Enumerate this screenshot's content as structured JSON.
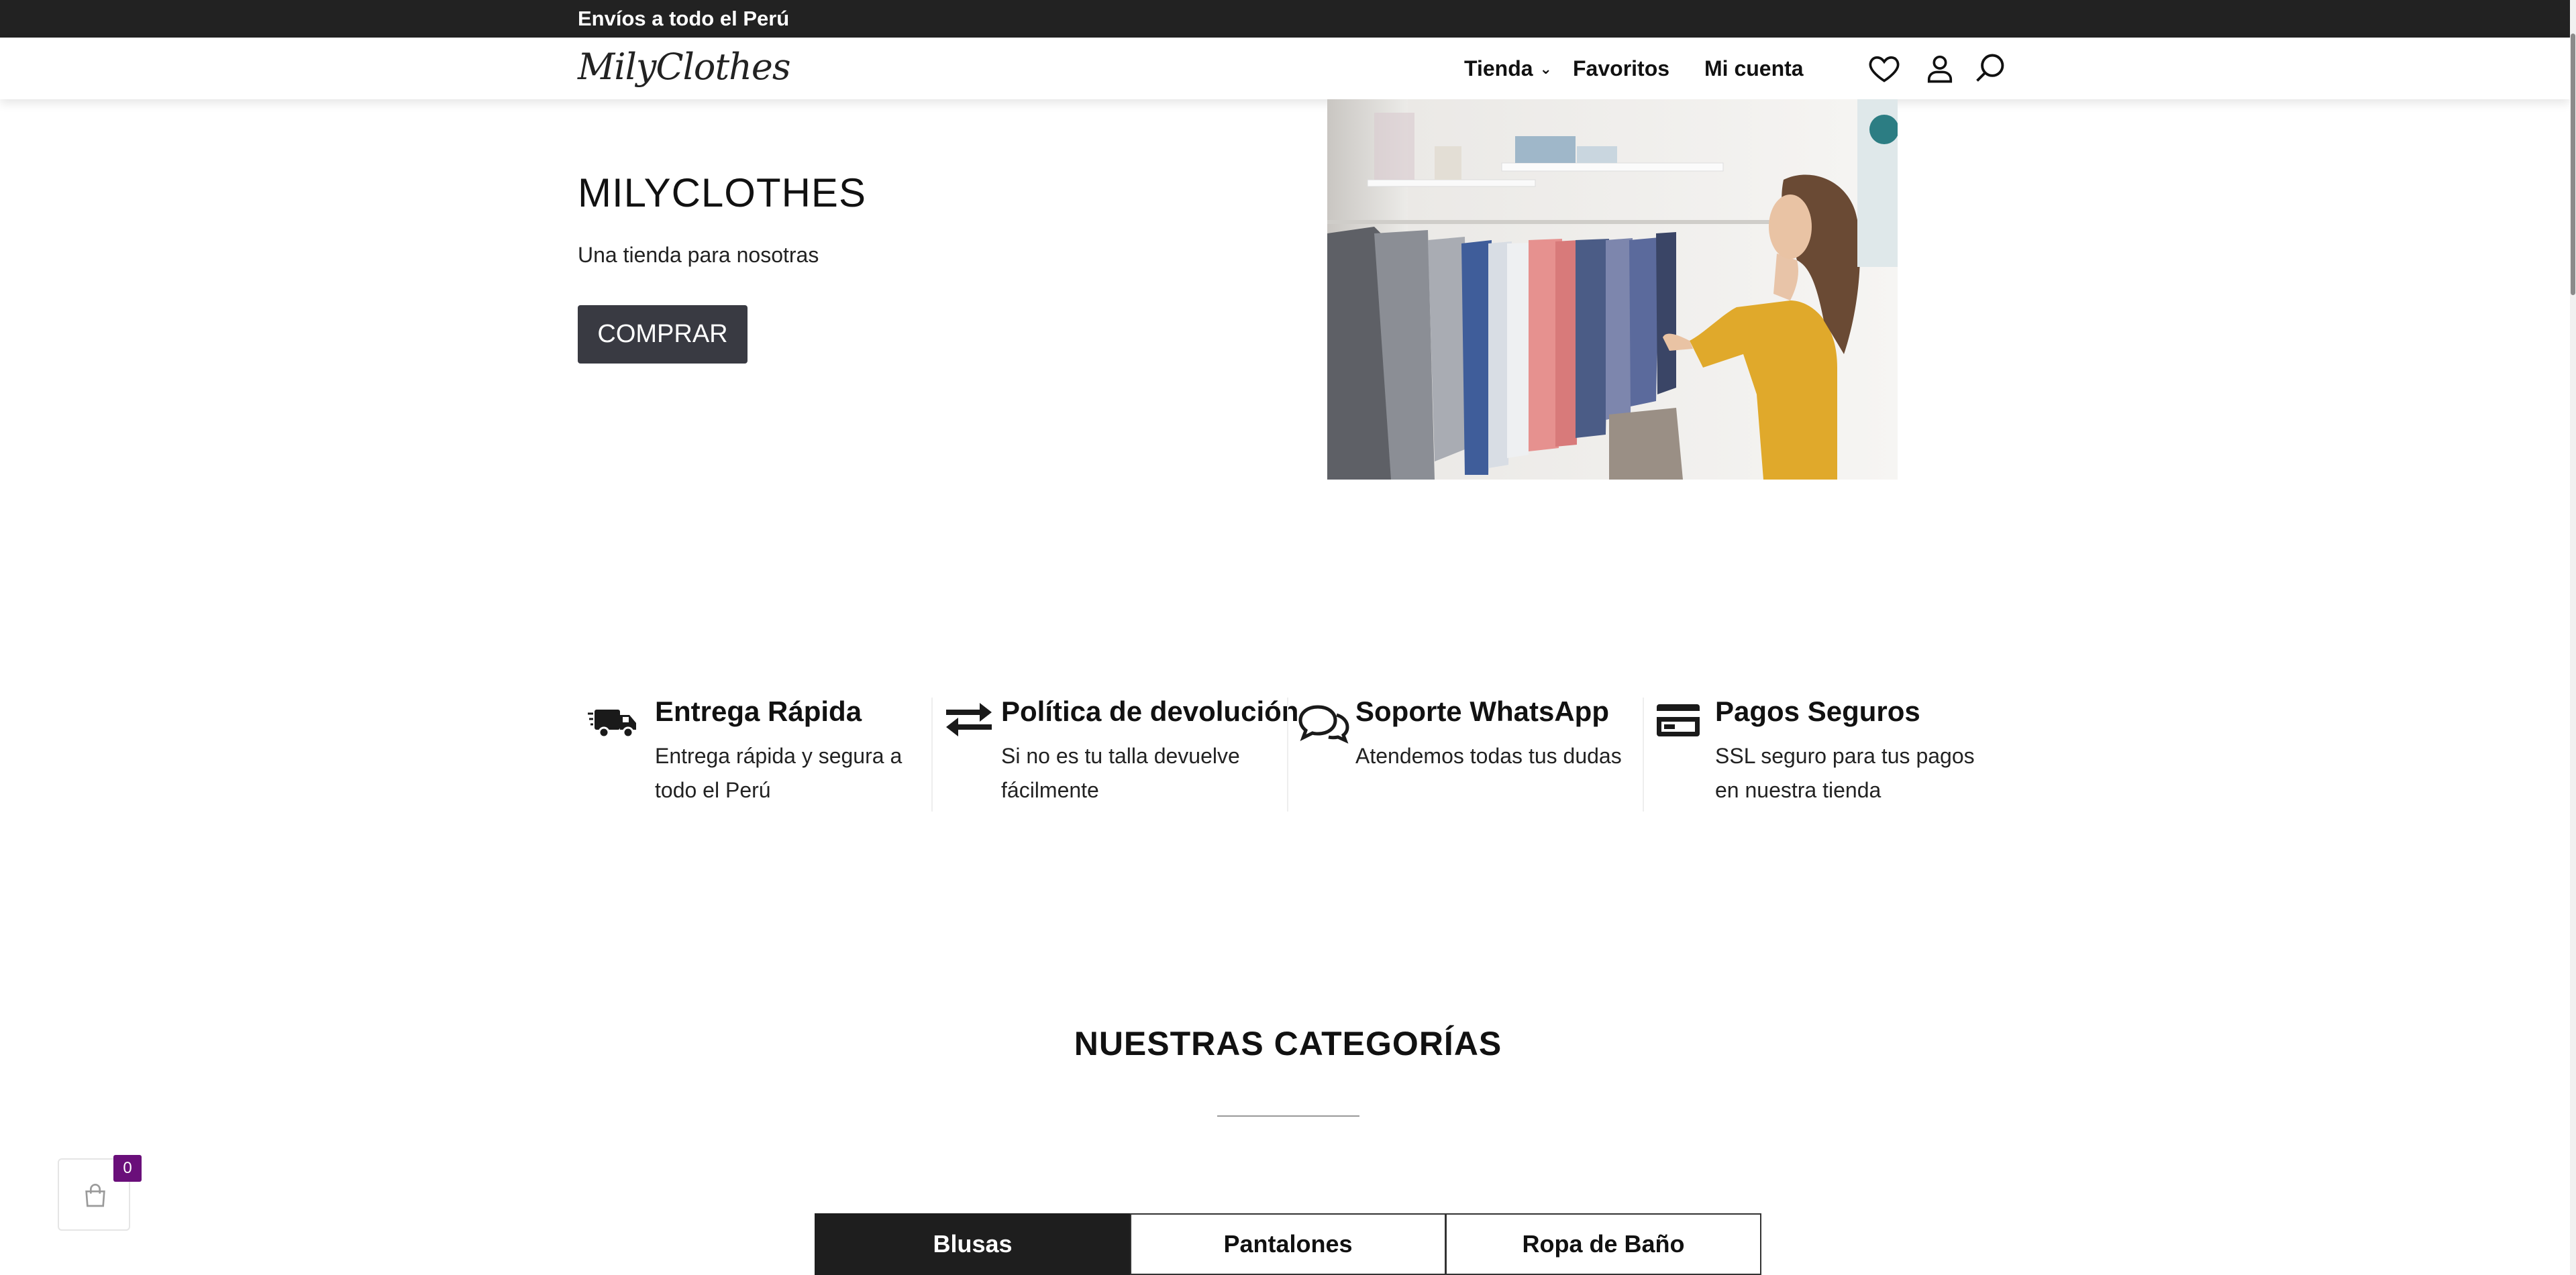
{
  "announcement": "Envíos a todo el Perú",
  "header": {
    "logo": "MilyClothes",
    "nav": [
      {
        "label": "Tienda",
        "has_dropdown": true
      },
      {
        "label": "Favoritos"
      },
      {
        "label": "Mi cuenta"
      }
    ],
    "icons": [
      "heart-icon",
      "user-icon",
      "search-icon"
    ]
  },
  "hero": {
    "title": "MILYCLOTHES",
    "subtitle": "Una tienda para nosotras",
    "cta_label": "COMPRAR"
  },
  "features": [
    {
      "icon": "delivery-truck-icon",
      "title": "Entrega Rápida",
      "line1": "Entrega rápida y segura a",
      "line2": "todo el Perú"
    },
    {
      "icon": "exchange-arrows-icon",
      "title": "Política de devolución",
      "line1": "Si no es tu talla devuelve",
      "line2": "fácilmente"
    },
    {
      "icon": "chat-bubbles-icon",
      "title": "Soporte WhatsApp",
      "line1": "Atendemos todas tus dudas",
      "line2": ""
    },
    {
      "icon": "credit-card-icon",
      "title": "Pagos Seguros",
      "line1": "SSL seguro para tus pagos",
      "line2": "en nuestra tienda"
    }
  ],
  "categories": {
    "title": "NUESTRAS CATEGORÍAS",
    "tabs": [
      {
        "label": "Blusas",
        "active": true
      },
      {
        "label": "Pantalones",
        "active": false
      },
      {
        "label": "Ropa de Baño",
        "active": false
      }
    ]
  },
  "cart": {
    "icon": "shopping-bag-icon",
    "count": "0"
  },
  "colors": {
    "topbar": "#222222",
    "button": "#393a42",
    "badge": "#6a0f7a",
    "active_tab": "#1e1e1e"
  }
}
